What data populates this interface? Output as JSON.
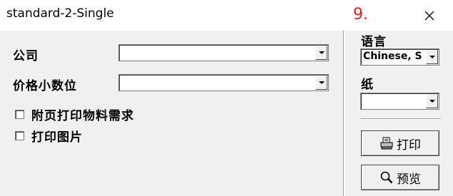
{
  "window": {
    "title": "standard-2-Single",
    "step_marker": "9."
  },
  "form": {
    "company_label": "公司",
    "company_value": "",
    "decimal_label": "价格小数位",
    "decimal_value": "",
    "attach_material_label": "附页打印物料需求",
    "attach_material_checked": false,
    "print_picture_label": "打印图片",
    "print_picture_checked": false
  },
  "side": {
    "language_label": "语言",
    "language_value": "Chinese, S",
    "paper_label": "纸",
    "paper_value": "",
    "print_button": "打印",
    "preview_button": "预览"
  },
  "icons": {
    "close": "close-icon",
    "print": "printer-icon",
    "preview": "magnifier-icon"
  }
}
